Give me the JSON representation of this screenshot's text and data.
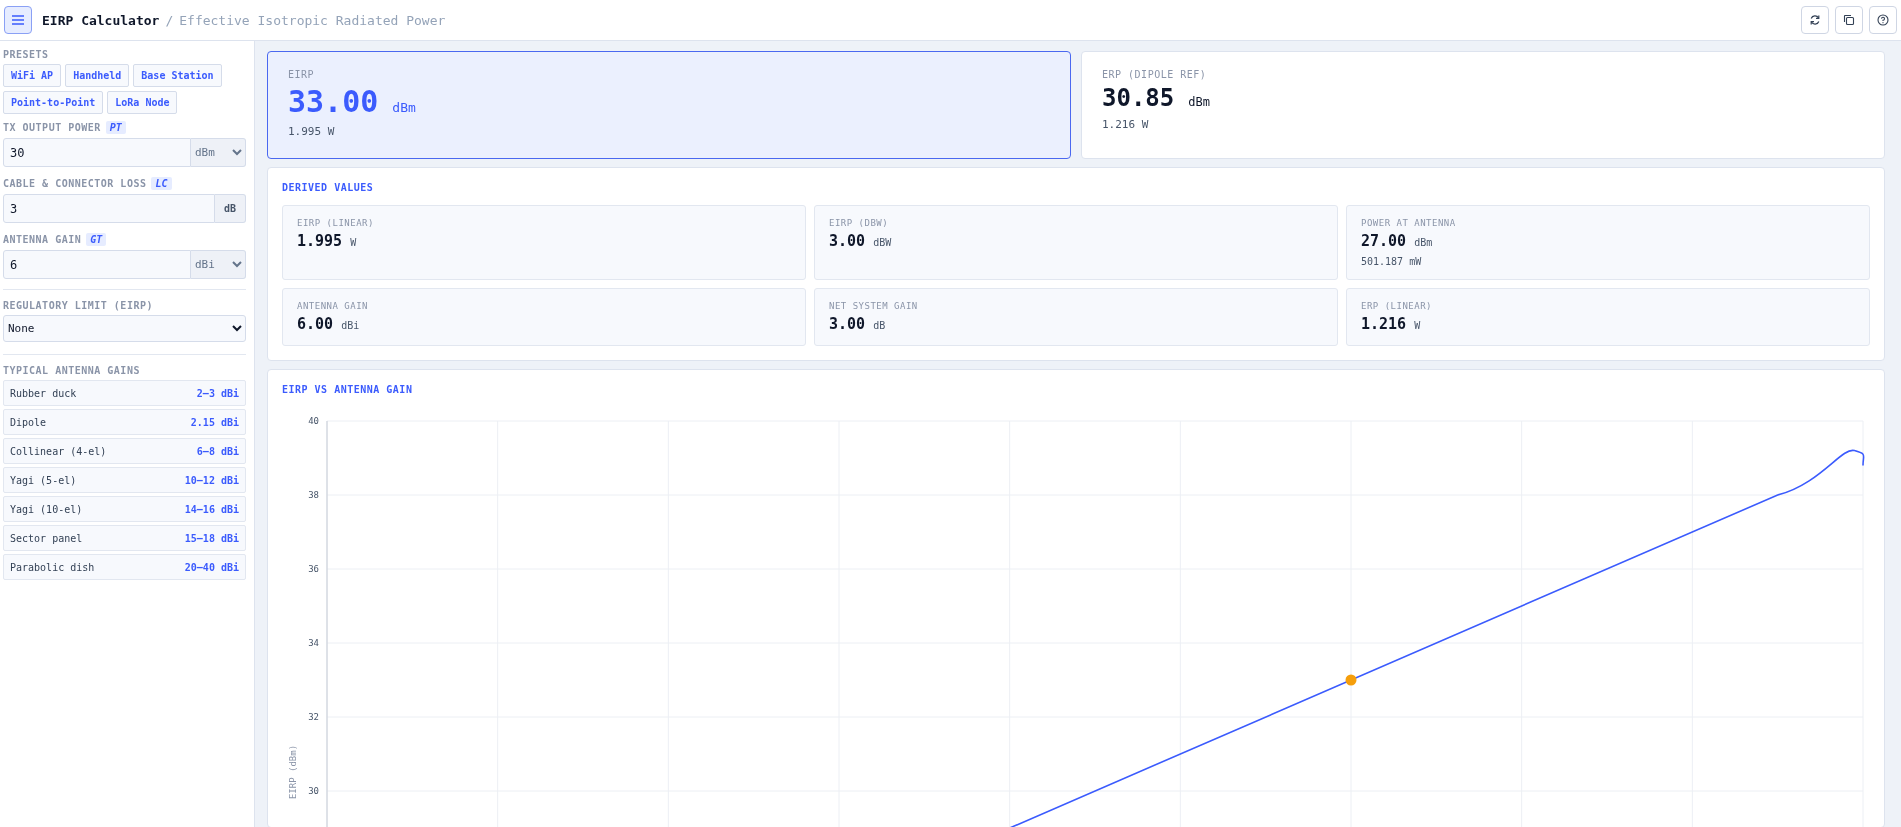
{
  "header": {
    "title": "EIRP Calculator",
    "separator": "/",
    "subtitle": "Effective Isotropic Radiated Power"
  },
  "sidebar": {
    "presets_heading": "PRESETS",
    "presets": [
      "WiFi AP",
      "Handheld",
      "Base Station",
      "Point-to-Point",
      "LoRa Node"
    ],
    "fields": [
      {
        "kind": "select-unit",
        "label": "TX OUTPUT POWER",
        "symbol": "PT",
        "value": "30",
        "unit": "dBm"
      },
      {
        "kind": "fixed-unit",
        "label": "CABLE & CONNECTOR LOSS",
        "symbol": "LC",
        "value": "3",
        "unit": "dB"
      },
      {
        "kind": "select-unit",
        "label": "ANTENNA GAIN",
        "symbol": "GT",
        "value": "6",
        "unit": "dBi"
      }
    ],
    "regulatory": {
      "label": "REGULATORY LIMIT (EIRP)",
      "value": "None"
    },
    "gains_heading": "TYPICAL ANTENNA GAINS",
    "gains": [
      {
        "name": "Rubber duck",
        "value": "2–3 dBi"
      },
      {
        "name": "Dipole",
        "value": "2.15 dBi"
      },
      {
        "name": "Collinear (4-el)",
        "value": "6–8 dBi"
      },
      {
        "name": "Yagi (5-el)",
        "value": "10–12 dBi"
      },
      {
        "name": "Yagi (10-el)",
        "value": "14–16 dBi"
      },
      {
        "name": "Sector panel",
        "value": "15–18 dBi"
      },
      {
        "name": "Parabolic dish",
        "value": "20–40 dBi"
      }
    ]
  },
  "results": [
    {
      "label": "EIRP",
      "value": "33.00",
      "unit": "dBm",
      "sub": "1.995 W",
      "selected": true
    },
    {
      "label": "ERP (DIPOLE REF)",
      "value": "30.85",
      "unit": "dBm",
      "sub": "1.216 W",
      "selected": false
    }
  ],
  "derived": {
    "title": "DERIVED VALUES",
    "items": [
      {
        "label": "EIRP (LINEAR)",
        "value": "1.995",
        "unit": "W"
      },
      {
        "label": "EIRP (DBW)",
        "value": "3.00",
        "unit": "dBW"
      },
      {
        "label": "POWER AT ANTENNA",
        "value": "27.00",
        "unit": "dBm",
        "sub": "501.187 mW"
      },
      {
        "label": "ANTENNA GAIN",
        "value": "6.00",
        "unit": "dBi"
      },
      {
        "label": "NET SYSTEM GAIN",
        "value": "3.00",
        "unit": "dB"
      },
      {
        "label": "ERP (LINEAR)",
        "value": "1.216",
        "unit": "W"
      }
    ]
  },
  "chart": {
    "title": "EIRP VS ANTENNA GAIN",
    "ylabel": "EIRP (dBm)",
    "yticks": [
      "40",
      "38",
      "36",
      "34",
      "32",
      "30"
    ]
  }
}
